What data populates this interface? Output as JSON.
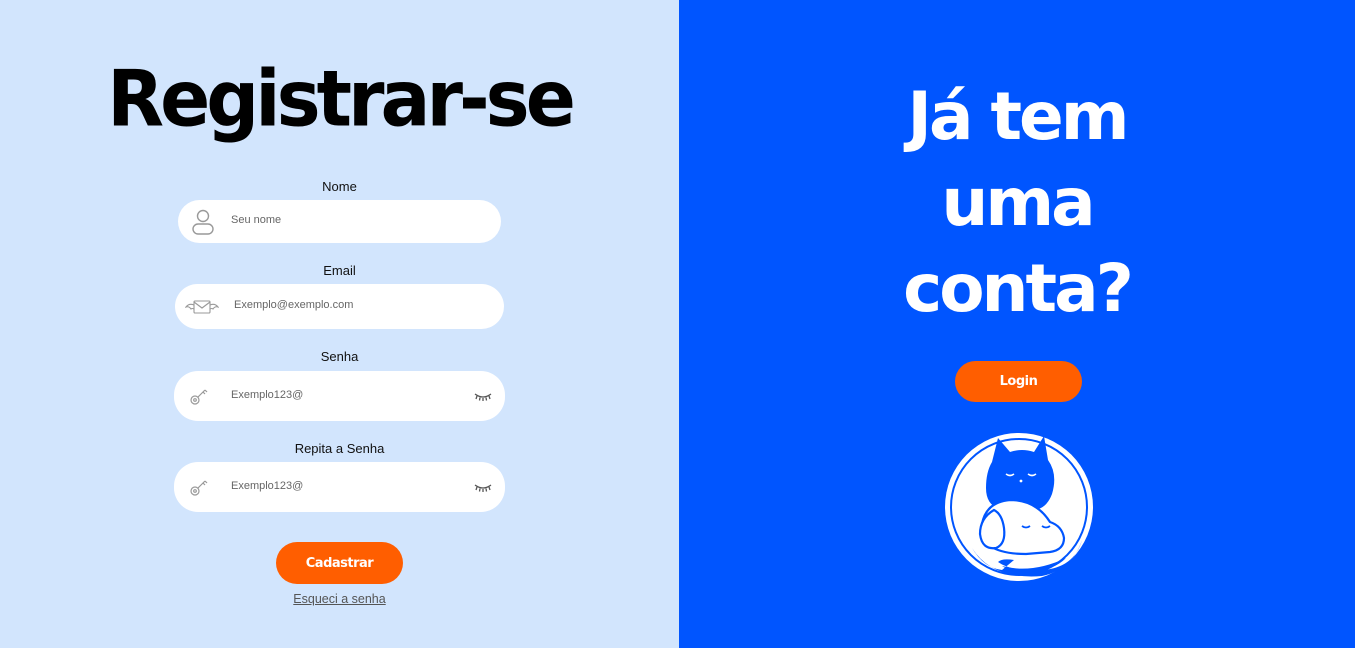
{
  "register": {
    "title": "Registrar-se",
    "name": {
      "label": "Nome",
      "placeholder": "Seu nome",
      "icon": "user-icon"
    },
    "email": {
      "label": "Email",
      "placeholder": "Exemplo@exemplo.com",
      "icon": "envelope-icon"
    },
    "password": {
      "label": "Senha",
      "placeholder": "Exemplo123@",
      "icon": "key-icon",
      "toggle_icon": "eye-closed-icon"
    },
    "repeat_password": {
      "label": "Repita a Senha",
      "placeholder": "Exemplo123@",
      "icon": "key-icon",
      "toggle_icon": "eye-closed-icon"
    },
    "submit_label": "Cadastrar",
    "forgot_label": "Esqueci a senha"
  },
  "login_panel": {
    "title_lines": [
      "Já tem",
      "uma",
      "conta?"
    ],
    "login_label": "Login",
    "logo": "cat-dog-logo"
  },
  "colors": {
    "left_bg": "#d2e5fd",
    "right_bg": "#0055ff",
    "accent": "#ff5e00"
  }
}
